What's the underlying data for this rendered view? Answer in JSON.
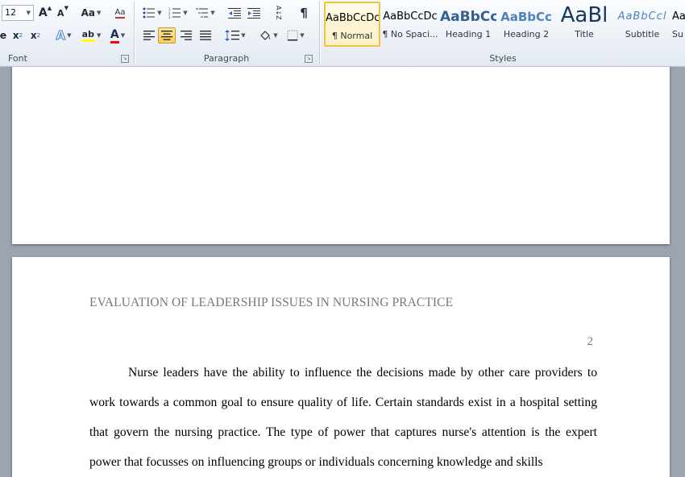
{
  "ribbon": {
    "font_group": {
      "label": "Font",
      "font_size": "12",
      "grow_font": "A",
      "shrink_font": "A",
      "change_case": "Aa",
      "clear_format": "Aa",
      "strike": "e",
      "subscript": "x",
      "subscript_mark": "2",
      "superscript": "x",
      "superscript_mark": "2",
      "text_effects": "A",
      "highlight": "ab",
      "font_color": "A",
      "highlight_color": "#ffff00",
      "font_color_value": "#ff0000"
    },
    "paragraph_group": {
      "label": "Paragraph",
      "sort": "A↓Z",
      "pilcrow": "¶"
    },
    "styles_group": {
      "label": "Styles",
      "items": [
        {
          "preview": "AaBbCcDc",
          "name": "¶ Normal",
          "selected": true
        },
        {
          "preview": "AaBbCcDc",
          "name": "¶ No Spaci..."
        },
        {
          "preview": "AaBbCc",
          "name": "Heading 1",
          "color": "#365f91"
        },
        {
          "preview": "AaBbCc",
          "name": "Heading 2",
          "color": "#4f81bd"
        },
        {
          "preview": "AaBl",
          "name": "Title",
          "color": "#17365d"
        },
        {
          "preview": "AaBbCcl",
          "name": "Subtitle",
          "color": "#4f81bd"
        },
        {
          "preview": "AaBbCcD",
          "name": "Su"
        }
      ]
    }
  },
  "document": {
    "header_title": "EVALUATION OF LEADERSHIP ISSUES IN NURSING PRACTICE",
    "page_number": "2",
    "paragraph": "Nurse leaders have the ability to influence the decisions made by other care providers to work towards a common goal to ensure quality of life. Certain standards exist in a hospital setting that govern the nursing practice. The type of power that captures nurse's attention is the expert power that focusses on influencing groups or individuals concerning knowledge and skills"
  }
}
